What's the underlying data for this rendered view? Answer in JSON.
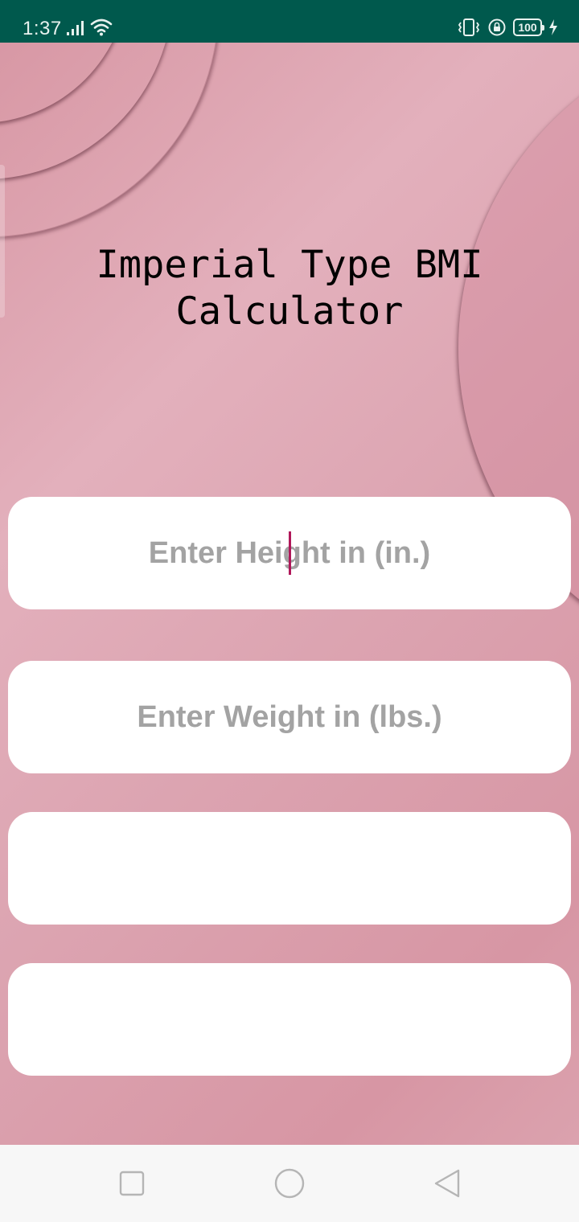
{
  "status_bar": {
    "time": "1:37",
    "battery_level": "100",
    "icons": [
      "signal-icon",
      "wifi-icon",
      "vibrate-icon",
      "rotation-lock-icon",
      "battery-icon",
      "charging-icon"
    ]
  },
  "page": {
    "title": "Imperial Type BMI\nCalculator"
  },
  "form": {
    "height_input": {
      "placeholder": "Enter Height in (in.)",
      "value": ""
    },
    "weight_input": {
      "placeholder": "Enter Weight in (lbs.)",
      "value": ""
    },
    "result_field_1": {
      "value": ""
    },
    "result_field_2": {
      "value": ""
    }
  },
  "nav_bar": {
    "buttons": [
      "recent-apps",
      "home",
      "back"
    ]
  },
  "colors": {
    "status_bar": "#00594d",
    "background_pink": "#dca4b1",
    "field_bg": "#ffffff",
    "placeholder": "#a3a3a3",
    "caret": "#b0185a"
  }
}
